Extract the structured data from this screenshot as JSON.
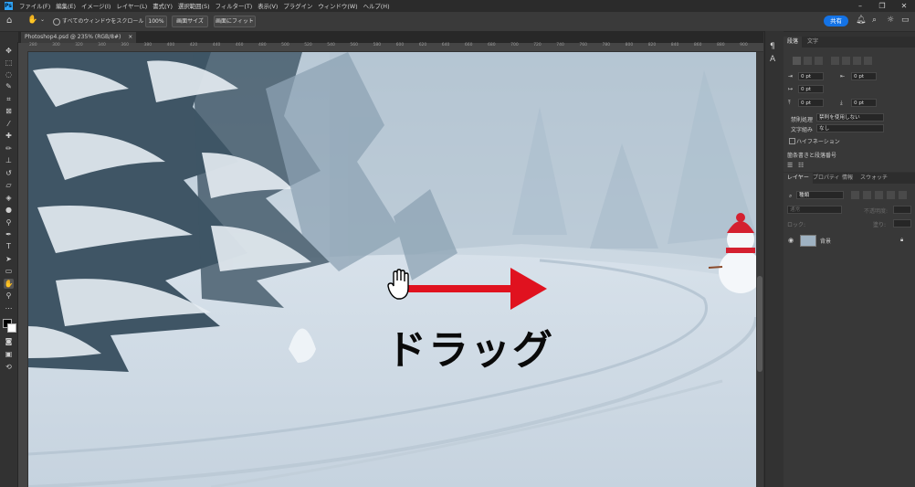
{
  "menu": [
    "ファイル(F)",
    "編集(E)",
    "イメージ(I)",
    "レイヤー(L)",
    "書式(Y)",
    "選択範囲(S)",
    "フィルター(T)",
    "表示(V)",
    "プラグイン",
    "ウィンドウ(W)",
    "ヘルプ(H)"
  ],
  "options": {
    "scroll_all_windows": "すべてのウィンドウをスクロール",
    "zoom_100": "100%",
    "fit_screen_size": "画面サイズ",
    "fit_to_screen": "画面にフィット",
    "share": "共有"
  },
  "document": {
    "tab_title": "Photoshop4.psd @ 235% (RGB/8#)",
    "close": "×"
  },
  "ruler_ticks": [
    "280",
    "300",
    "320",
    "340",
    "360",
    "380",
    "400",
    "420",
    "440",
    "460",
    "480",
    "500",
    "520",
    "540",
    "560",
    "580",
    "600",
    "620",
    "640",
    "660",
    "680",
    "700",
    "720",
    "740",
    "760",
    "780",
    "800",
    "820",
    "840",
    "860",
    "880",
    "900"
  ],
  "overlay": {
    "drag_label": "ドラッグ"
  },
  "paragraph_panel": {
    "tabs": [
      "段落",
      "文字"
    ],
    "indent_left": "0 pt",
    "indent_right": "0 pt",
    "indent_first": "0 pt",
    "space_before": "0 pt",
    "space_after": "0 pt",
    "kinsoku_label": "禁則処理",
    "kinsoku_value": "禁則を使用しない",
    "mojikumi_label": "文字組み",
    "mojikumi_value": "なし",
    "hyphenation": "ハイフネーション",
    "bullets_label": "箇条書きと段落番号"
  },
  "layers_panel": {
    "tabs": [
      "レイヤー",
      "プロパティ",
      "情報",
      "スウォッチ"
    ],
    "kind_filter": "種類",
    "blend_mode": "通常",
    "opacity_label": "不透明度:",
    "lock_label": "ロック:",
    "fill_label": "塗り:",
    "layer_name": "背景"
  },
  "colors": {
    "accent": "#1473e6",
    "arrow": "#e0121f"
  }
}
